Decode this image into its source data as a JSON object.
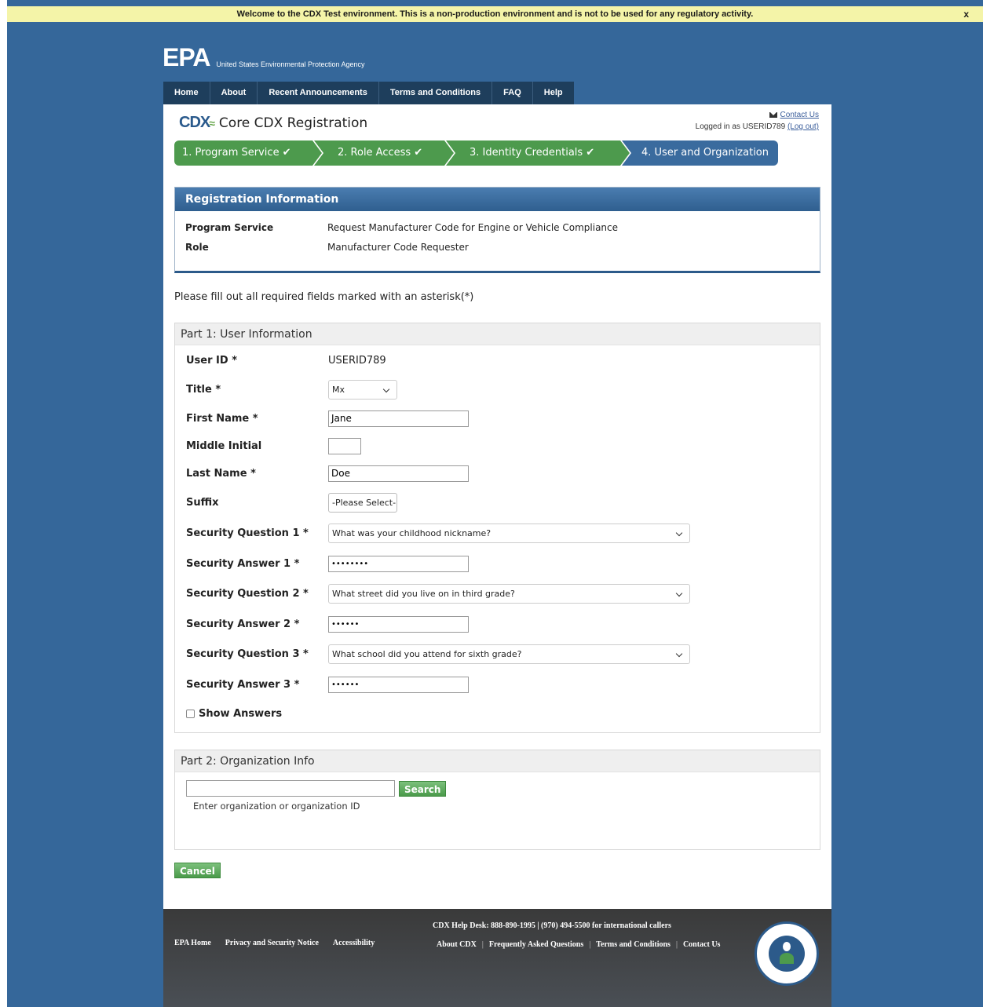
{
  "banner": {
    "text": "Welcome to the CDX Test environment. This is a non-production environment and is not to be used for any regulatory activity.",
    "close": "x"
  },
  "logo": {
    "mark": "EPA",
    "agency": "United States Environmental Protection Agency"
  },
  "nav": [
    "Home",
    "About",
    "Recent Announcements",
    "Terms and Conditions",
    "FAQ",
    "Help"
  ],
  "header": {
    "cdx": "CDX",
    "title": "Core CDX Registration",
    "contact": "Contact Us",
    "logged_in": "Logged in as USERID789",
    "logout": "(Log out)"
  },
  "steps": [
    {
      "label": "1. Program Service",
      "status": "done"
    },
    {
      "label": "2. Role Access",
      "status": "done"
    },
    {
      "label": "3. Identity Credentials",
      "status": "done"
    },
    {
      "label": "4. User and Organization",
      "status": "current"
    }
  ],
  "registration": {
    "title": "Registration Information",
    "program_label": "Program Service",
    "program_value": "Request Manufacturer Code for Engine or Vehicle Compliance",
    "role_label": "Role",
    "role_value": "Manufacturer Code Requester"
  },
  "instructions": "Please fill out all required fields marked with an asterisk(*)",
  "part1": {
    "title": "Part 1: User Information",
    "user_id_label": "User ID *",
    "user_id_value": "USERID789",
    "title_label": "Title *",
    "title_value": "Mx",
    "first_name_label": "First Name *",
    "first_name_value": "Jane",
    "middle_label": "Middle Initial",
    "middle_value": "",
    "last_name_label": "Last Name *",
    "last_name_value": "Doe",
    "suffix_label": "Suffix",
    "suffix_value": "-Please Select-",
    "sq1_label": "Security Question 1 *",
    "sq1_value": "What was your childhood nickname?",
    "sa1_label": "Security Answer 1 *",
    "sa1_value": "••••••••",
    "sq2_label": "Security Question 2 *",
    "sq2_value": "What street did you live on in third grade?",
    "sa2_label": "Security Answer 2 *",
    "sa2_value": "••••••",
    "sq3_label": "Security Question 3 *",
    "sq3_value": "What school did you attend for sixth grade?",
    "sa3_label": "Security Answer 3 *",
    "sa3_value": "••••••",
    "show_answers": "Show Answers"
  },
  "part2": {
    "title": "Part 2: Organization Info",
    "search_label": "Search",
    "hint": "Enter organization or organization ID"
  },
  "cancel_label": "Cancel",
  "footer": {
    "left_links": [
      "EPA Home",
      "Privacy and Security Notice",
      "Accessibility"
    ],
    "helpdesk": "CDX Help Desk: 888-890-1995 | (970) 494-5500 for international callers",
    "right_links": [
      "About CDX",
      "Frequently Asked Questions",
      "Terms and Conditions",
      "Contact Us"
    ]
  },
  "colors": {
    "page_bg": "#35679a",
    "step_done": "#4d9a4d",
    "step_current": "#3a6b9e",
    "banner_bg": "#f4f4a8"
  }
}
